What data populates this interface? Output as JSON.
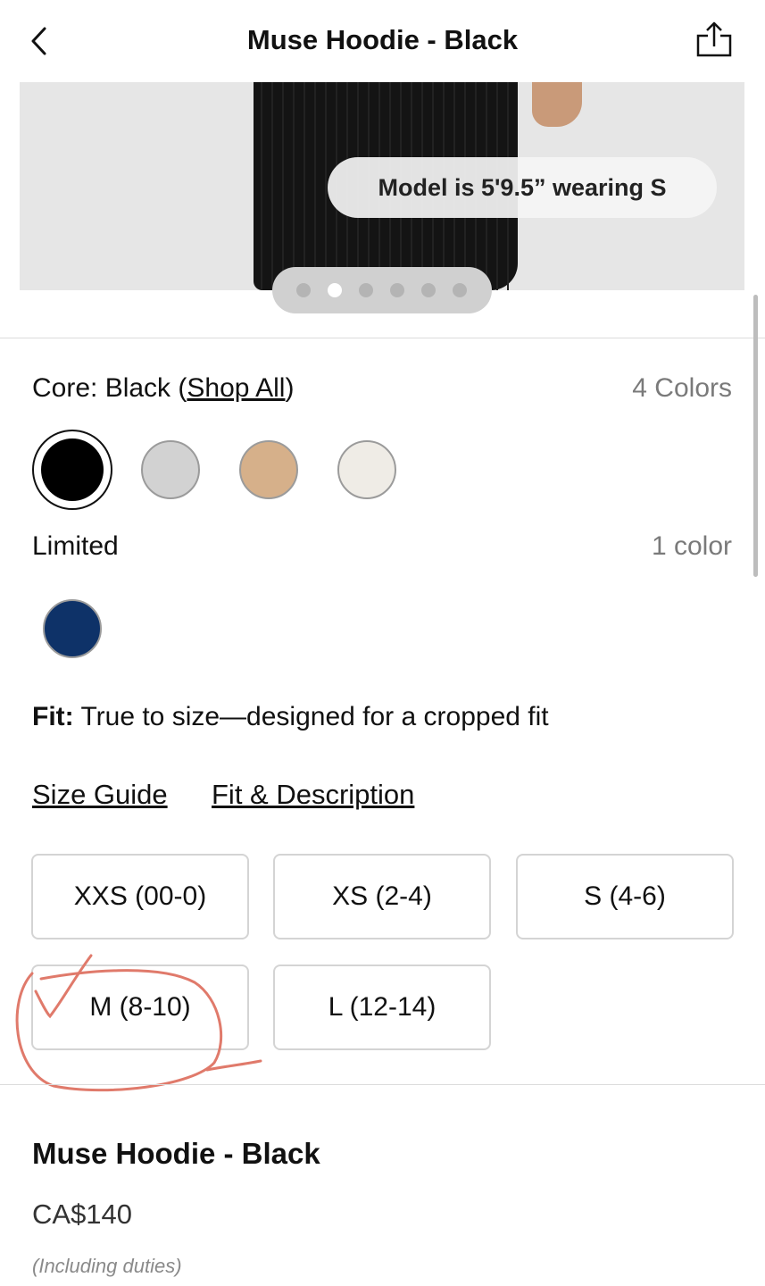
{
  "header": {
    "title": "Muse Hoodie - Black",
    "back_icon": "chevron-left-icon",
    "share_icon": "share-icon"
  },
  "hero": {
    "model_note": "Model is 5'9.5” wearing S",
    "carousel": {
      "total": 6,
      "active_index": 1
    }
  },
  "colors": {
    "core_prefix": "Core: Black (",
    "core_link": "Shop All",
    "core_suffix": ")",
    "core_count": "4 Colors",
    "core_swatches": [
      {
        "name": "Black",
        "hex": "#000000",
        "selected": true
      },
      {
        "name": "Heather Grey",
        "hex": "#d2d2d2",
        "selected": false
      },
      {
        "name": "Tan",
        "hex": "#d6b08a",
        "selected": false
      },
      {
        "name": "Cream",
        "hex": "#efece6",
        "selected": false
      }
    ],
    "limited_label": "Limited",
    "limited_count": "1 color",
    "limited_swatches": [
      {
        "name": "Navy",
        "hex": "#0e3268",
        "selected": false
      }
    ]
  },
  "fit": {
    "label": "Fit:",
    "text": "True to size—designed for a cropped fit"
  },
  "links": {
    "size_guide": "Size Guide",
    "fit_description": "Fit & Description"
  },
  "sizes": [
    "XXS (00-0)",
    "XS (2-4)",
    "S (4-6)",
    "M (8-10)",
    "L (12-14)"
  ],
  "annotation": {
    "type": "hand-drawn checkmark and circle",
    "target": "M (8-10)",
    "color": "#e07a6b"
  },
  "product": {
    "title": "Muse Hoodie - Black",
    "price": "CA$140",
    "duties": "(Including duties)"
  }
}
